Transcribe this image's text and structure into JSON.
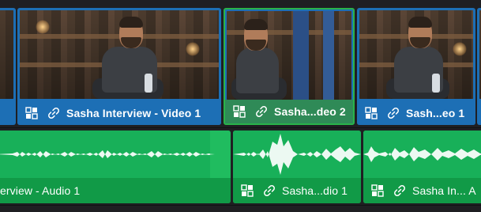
{
  "timeline": {
    "video_track": {
      "clips": [
        {
          "name": "Sasha Interview - Video 1",
          "selected": false
        },
        {
          "name": "Sasha...deo 2",
          "selected": true
        },
        {
          "name": "Sash...eo 1",
          "selected": false
        }
      ]
    },
    "audio_track": {
      "clips": [
        {
          "name": "erview - Audio 1"
        },
        {
          "name": "Sasha...dio 1"
        },
        {
          "name": "Sasha In... A"
        }
      ]
    }
  },
  "icons": {
    "clip_type": "multicam-grid-icon",
    "linked": "link-icon"
  },
  "colors": {
    "video_clip": "#1d6fb5",
    "selected_border": "#29b34a",
    "audio_clip": "#16a34f",
    "waveform": "#ffffff",
    "background": "#1f1f22"
  }
}
